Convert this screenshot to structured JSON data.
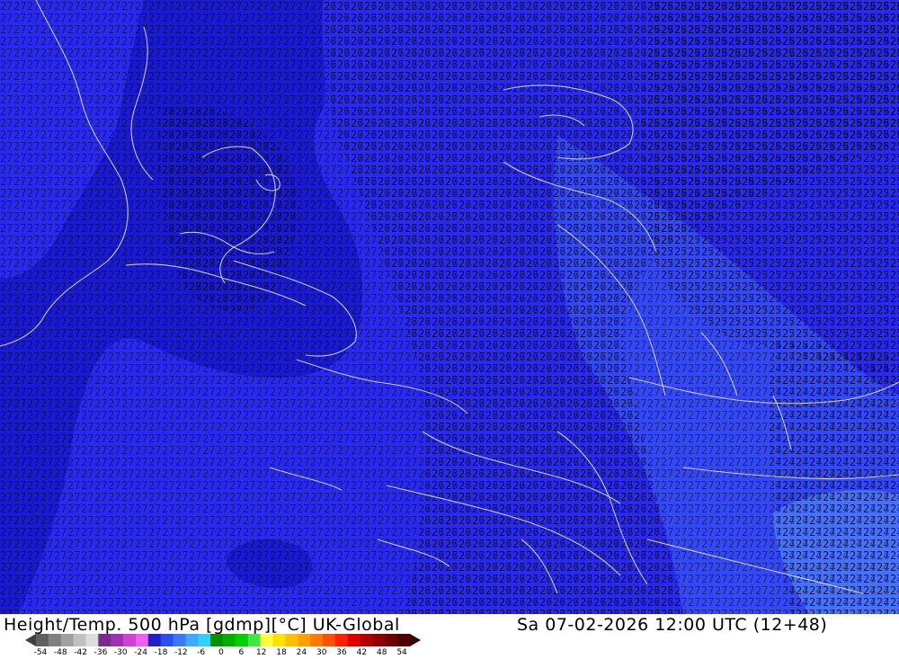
{
  "map": {
    "field": "height-temperature-500hPa",
    "value_labels": [
      "24",
      "25",
      "26",
      "27",
      "28",
      "29"
    ],
    "colors": {
      "temp_minus_30": "#1a1ad0",
      "temp_minus_27": "#2a2aee",
      "temp_minus_24": "#3448f6",
      "temp_minus_21": "#4870ff",
      "contour": "#c8c8d8",
      "label": "#000000"
    }
  },
  "footer": {
    "title_left": "Height/Temp. 500 hPa [gdmp][°C] UK-Global",
    "title_right": "Sa 07-02-2026 12:00 UTC (12+48)"
  },
  "colorbar": {
    "ticks": [
      "-54",
      "-48",
      "-42",
      "-36",
      "-30",
      "-24",
      "-18",
      "-12",
      "-6",
      "0",
      "6",
      "12",
      "18",
      "24",
      "30",
      "36",
      "42",
      "48",
      "54"
    ],
    "colors": [
      "#606060",
      "#808080",
      "#a0a0a0",
      "#c0c0c0",
      "#dcdcdc",
      "#7a2a8a",
      "#a030b0",
      "#d040d8",
      "#f060f0",
      "#2020c8",
      "#2a4ef0",
      "#3c78ff",
      "#40a8ff",
      "#30d0ff",
      "#009000",
      "#00b000",
      "#00d000",
      "#40e840",
      "#ffff40",
      "#ffe000",
      "#ffc000",
      "#ffa000",
      "#ff7800",
      "#ff5000",
      "#ff2000",
      "#e00000",
      "#b00000",
      "#900000",
      "#700000",
      "#500000"
    ]
  }
}
